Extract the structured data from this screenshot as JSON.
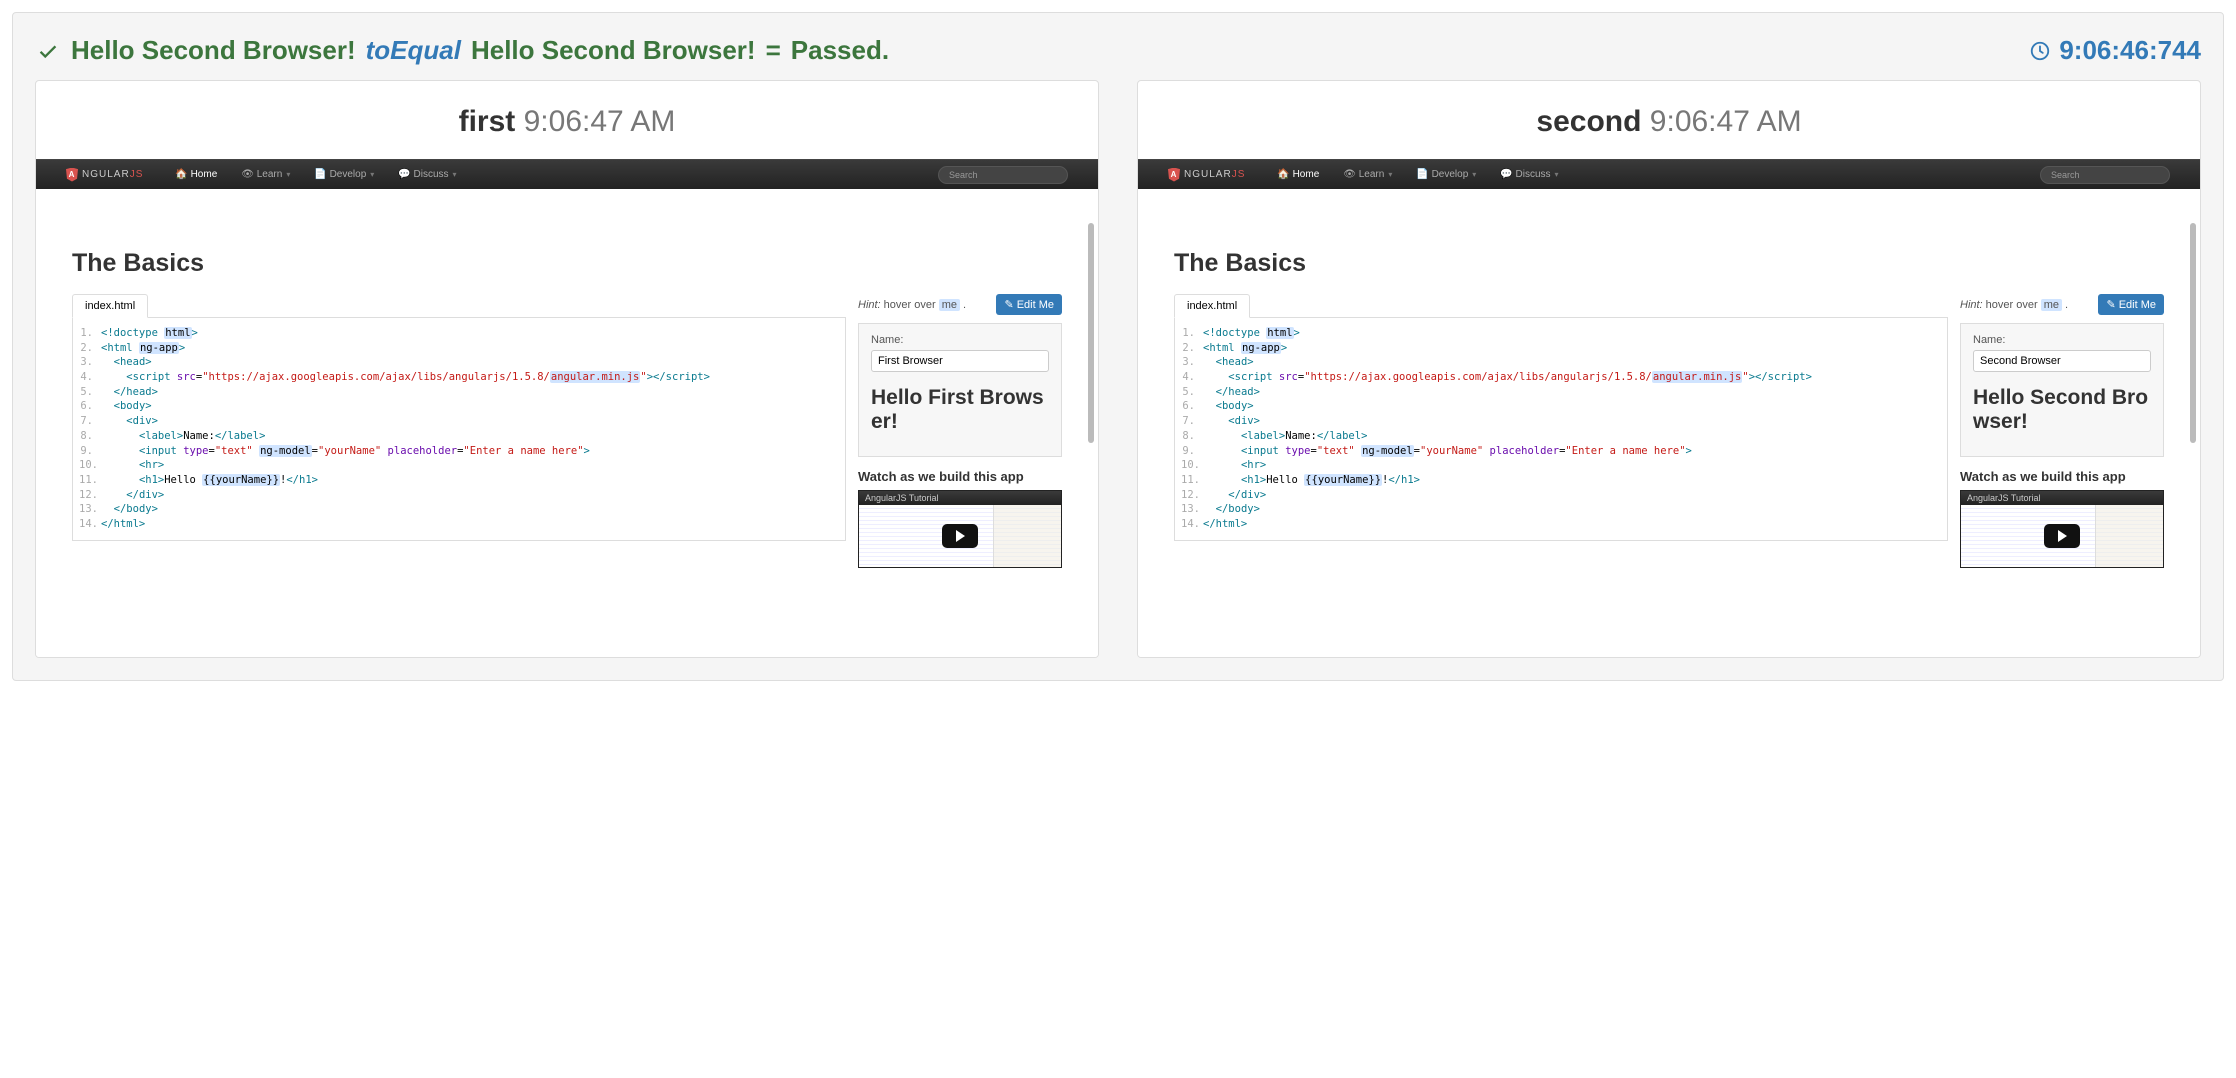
{
  "result": {
    "actual": "Hello Second Browser!",
    "matcher": "toEqual",
    "expected": "Hello Second Browser!",
    "outcome": "Passed."
  },
  "timestamp": "9:06:46:744",
  "nav": {
    "brand_prefix": "NGULAR",
    "brand_suffix": "JS",
    "home": "Home",
    "learn": "Learn",
    "develop": "Develop",
    "discuss": "Discuss",
    "search_placeholder": "Search"
  },
  "basics_heading": "The Basics",
  "tab_label": "index.html",
  "hint_prefix": "Hint:",
  "hint_text": "hover over",
  "hint_me": "me",
  "editme": "Edit Me",
  "watch_heading": "Watch as we build this app",
  "video_title": "AngularJS Tutorial",
  "name_label": "Name:",
  "code": [
    {
      "n": "1.",
      "html": "<span class='c-tag'>&lt;!doctype</span> <span class='c-hl'>html</span><span class='c-tag'>&gt;</span>"
    },
    {
      "n": "2.",
      "html": "<span class='c-tag'>&lt;html</span> <span class='c-hl'>ng-app</span><span class='c-tag'>&gt;</span>"
    },
    {
      "n": "3.",
      "html": "&nbsp;&nbsp;<span class='c-tag'>&lt;head&gt;</span>"
    },
    {
      "n": "4.",
      "html": "&nbsp;&nbsp;&nbsp;&nbsp;<span class='c-tag'>&lt;script</span> <span class='c-attr'>src</span>=<span class='c-str'>\"https://ajax.googleapis.com/ajax/libs/angularjs/1.5.8/<span class='c-hl'>angular.min.js</span>\"</span><span class='c-tag'>&gt;&lt;/script&gt;</span>"
    },
    {
      "n": "5.",
      "html": "&nbsp;&nbsp;<span class='c-tag'>&lt;/head&gt;</span>"
    },
    {
      "n": "6.",
      "html": "&nbsp;&nbsp;<span class='c-tag'>&lt;body&gt;</span>"
    },
    {
      "n": "7.",
      "html": "&nbsp;&nbsp;&nbsp;&nbsp;<span class='c-tag'>&lt;div&gt;</span>"
    },
    {
      "n": "8.",
      "html": "&nbsp;&nbsp;&nbsp;&nbsp;&nbsp;&nbsp;<span class='c-tag'>&lt;label&gt;</span>Name:<span class='c-tag'>&lt;/label&gt;</span>"
    },
    {
      "n": "9.",
      "html": "&nbsp;&nbsp;&nbsp;&nbsp;&nbsp;&nbsp;<span class='c-tag'>&lt;input</span> <span class='c-attr'>type</span>=<span class='c-str'>\"text\"</span> <span class='c-hl'>ng-model</span>=<span class='c-str'>\"yourName\"</span> <span class='c-attr'>placeholder</span>=<span class='c-str'>\"Enter a name here\"</span><span class='c-tag'>&gt;</span>"
    },
    {
      "n": "10.",
      "html": "&nbsp;&nbsp;&nbsp;&nbsp;&nbsp;&nbsp;<span class='c-tag'>&lt;hr&gt;</span>"
    },
    {
      "n": "11.",
      "html": "&nbsp;&nbsp;&nbsp;&nbsp;&nbsp;&nbsp;<span class='c-tag'>&lt;h1&gt;</span>Hello <span class='c-hl'>{{yourName}}</span>!<span class='c-tag'>&lt;/h1&gt;</span>"
    },
    {
      "n": "12.",
      "html": "&nbsp;&nbsp;&nbsp;&nbsp;<span class='c-tag'>&lt;/div&gt;</span>"
    },
    {
      "n": "13.",
      "html": "&nbsp;&nbsp;<span class='c-tag'>&lt;/body&gt;</span>"
    },
    {
      "n": "14.",
      "html": "<span class='c-tag'>&lt;/html&gt;</span>"
    }
  ],
  "panels": [
    {
      "name": "first",
      "time": "9:06:47 AM",
      "input_value": "First Browser",
      "hello_line1": "Hello First Brows",
      "hello_line2": "er!"
    },
    {
      "name": "second",
      "time": "9:06:47 AM",
      "input_value": "Second Browser",
      "hello_line1": "Hello Second Bro",
      "hello_line2": "wser!"
    }
  ]
}
